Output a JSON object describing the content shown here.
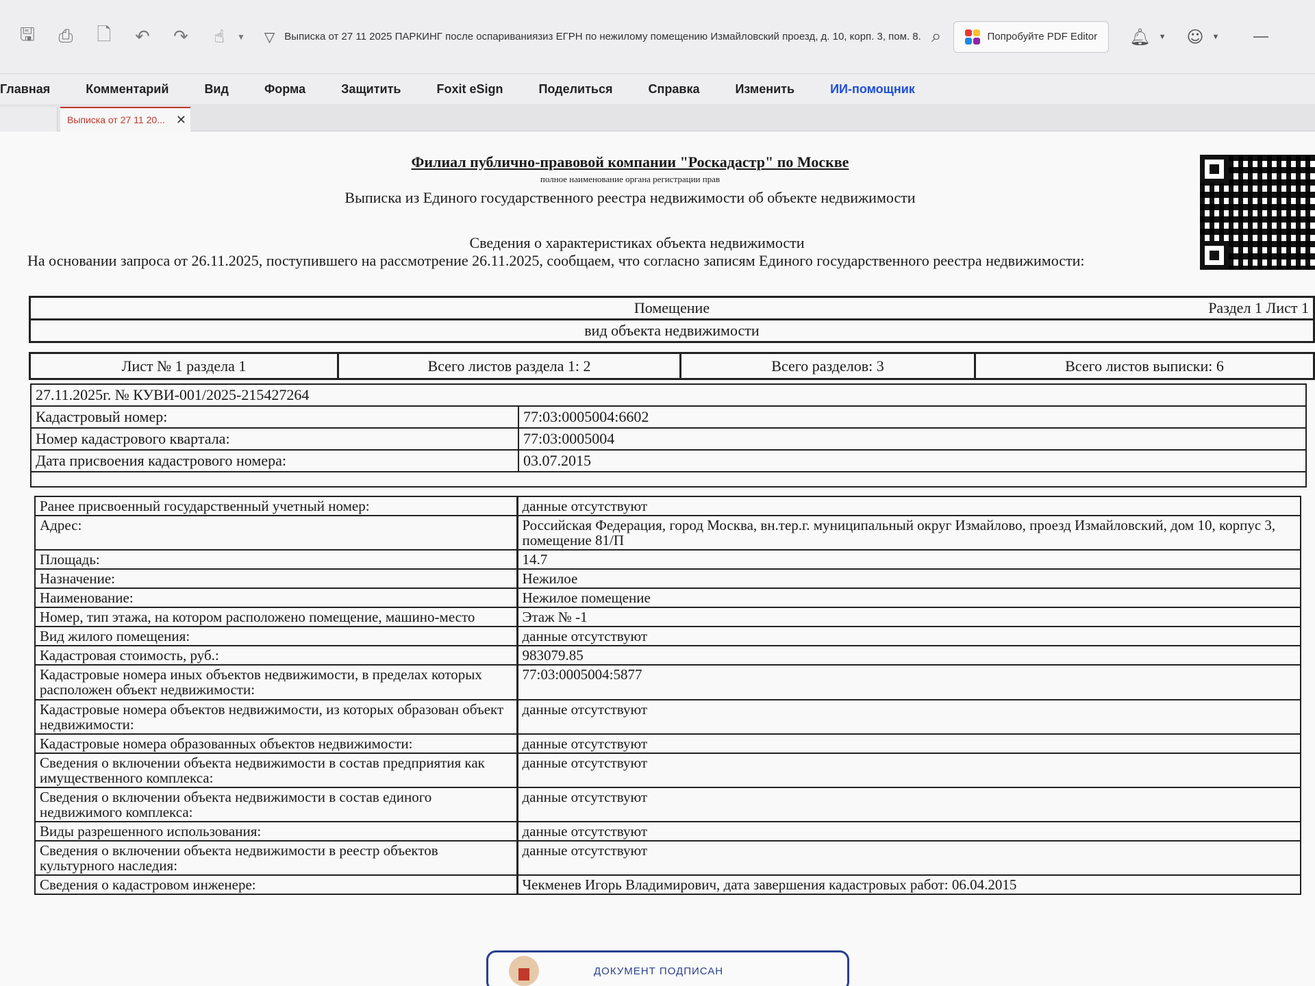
{
  "toolbar": {
    "title": "Выписка от 27 11 2025 ПАРКИНГ после оспариваниязиз ЕГРН по нежилому помещению Измайловский проезд, д. 10, корп. 3, пом. 8...",
    "pdf_editor_label": "Попробуйте PDF Editor",
    "icons": [
      "save-icon",
      "print-icon",
      "new-doc-icon",
      "undo-icon",
      "redo-icon",
      "hand-tool-icon",
      "shield-icon",
      "search-icon",
      "bell-icon",
      "user-icon"
    ],
    "logo_colors": [
      "#e53935",
      "#fbc02d",
      "#1e88e5",
      "#8e24aa"
    ]
  },
  "menu": {
    "items": [
      "Главная",
      "Комментарий",
      "Вид",
      "Форма",
      "Защитить",
      "Foxit eSign",
      "Поделиться",
      "Справка",
      "Изменить",
      "ИИ-помощник"
    ],
    "accent_color": "#1e4fd8"
  },
  "tab": {
    "label": "Выписка от 27 11 20..."
  },
  "document": {
    "org_title": "Филиал публично-правовой компании \"Роскадастр\" по Москве",
    "org_subtitle": "полное наименование органа регистрации прав",
    "title": "Выписка из Единого государственного реестра недвижимости об объекте недвижимости",
    "section_title": "Сведения о характеристиках объекта недвижимости",
    "basis_text": "На  основании запроса от 26.11.2025, поступившего на рассмотрение 26.11.2025, сообщаем, что согласно записям Единого государственного реестра недвижимости:",
    "sheet_meta": "Раздел 1 Лист 1",
    "object_type": "Помещение",
    "object_type_caption": "вид объекта недвижимости",
    "sheet_no": "Лист № 1 раздела 1",
    "sheets_in_section": "Всего листов раздела 1: 2",
    "sections_total": "Всего разделов: 3",
    "sheets_total": "Всего листов выписки: 6",
    "record_no": "27.11.2025г. № КУВИ-001/2025-215427264",
    "ident": [
      {
        "label": "Кадастровый номер:",
        "value": "77:03:0005004:6602"
      },
      {
        "label": "Номер кадастрового квартала:",
        "value": "77:03:0005004"
      },
      {
        "label": "Дата присвоения кадастрового номера:",
        "value": "03.07.2015"
      }
    ],
    "rows": [
      {
        "label": "Ранее присвоенный государственный учетный номер:",
        "value": "данные отсутствуют"
      },
      {
        "label": "Адрес:",
        "value": "Российская Федерация, город Москва, вн.тер.г. муниципальный округ Измайлово, проезд Измайловский, дом 10, корпус 3, помещение 81/П"
      },
      {
        "label": "Площадь:",
        "value": "14.7"
      },
      {
        "label": "Назначение:",
        "value": "Нежилое"
      },
      {
        "label": "Наименование:",
        "value": "Нежилое помещение"
      },
      {
        "label": "Номер, тип этажа, на котором расположено помещение, машино-место",
        "value": "Этаж № -1"
      },
      {
        "label": "Вид жилого помещения:",
        "value": "данные отсутствуют"
      },
      {
        "label": "Кадастровая стоимость, руб.:",
        "value": "983079.85"
      },
      {
        "label": "Кадастровые номера иных объектов недвижимости, в пределах которых расположен объект недвижимости:",
        "value": "77:03:0005004:5877"
      },
      {
        "label": "Кадастровые номера объектов недвижимости, из которых образован объект недвижимости:",
        "value": "данные отсутствуют"
      },
      {
        "label": "Кадастровые номера образованных объектов недвижимости:",
        "value": "данные отсутствуют"
      },
      {
        "label": "Сведения о включении объекта недвижимости в состав предприятия как имущественного комплекса:",
        "value": "данные отсутствуют"
      },
      {
        "label": "Сведения о включении объекта недвижимости в состав единого недвижимого комплекса:",
        "value": "данные отсутствуют"
      },
      {
        "label": "Виды разрешенного использования:",
        "value": "данные отсутствуют"
      },
      {
        "label": "Сведения о включении объекта недвижимости в реестр объектов культурного наследия:",
        "value": "данные отсутствуют"
      },
      {
        "label": "Сведения о кадастровом инженере:",
        "value": "Чекменев Игорь Владимирович, дата завершения кадастровых работ: 06.04.2015"
      }
    ],
    "signed_badge": "ДОКУМЕНТ ПОДПИСАН"
  }
}
